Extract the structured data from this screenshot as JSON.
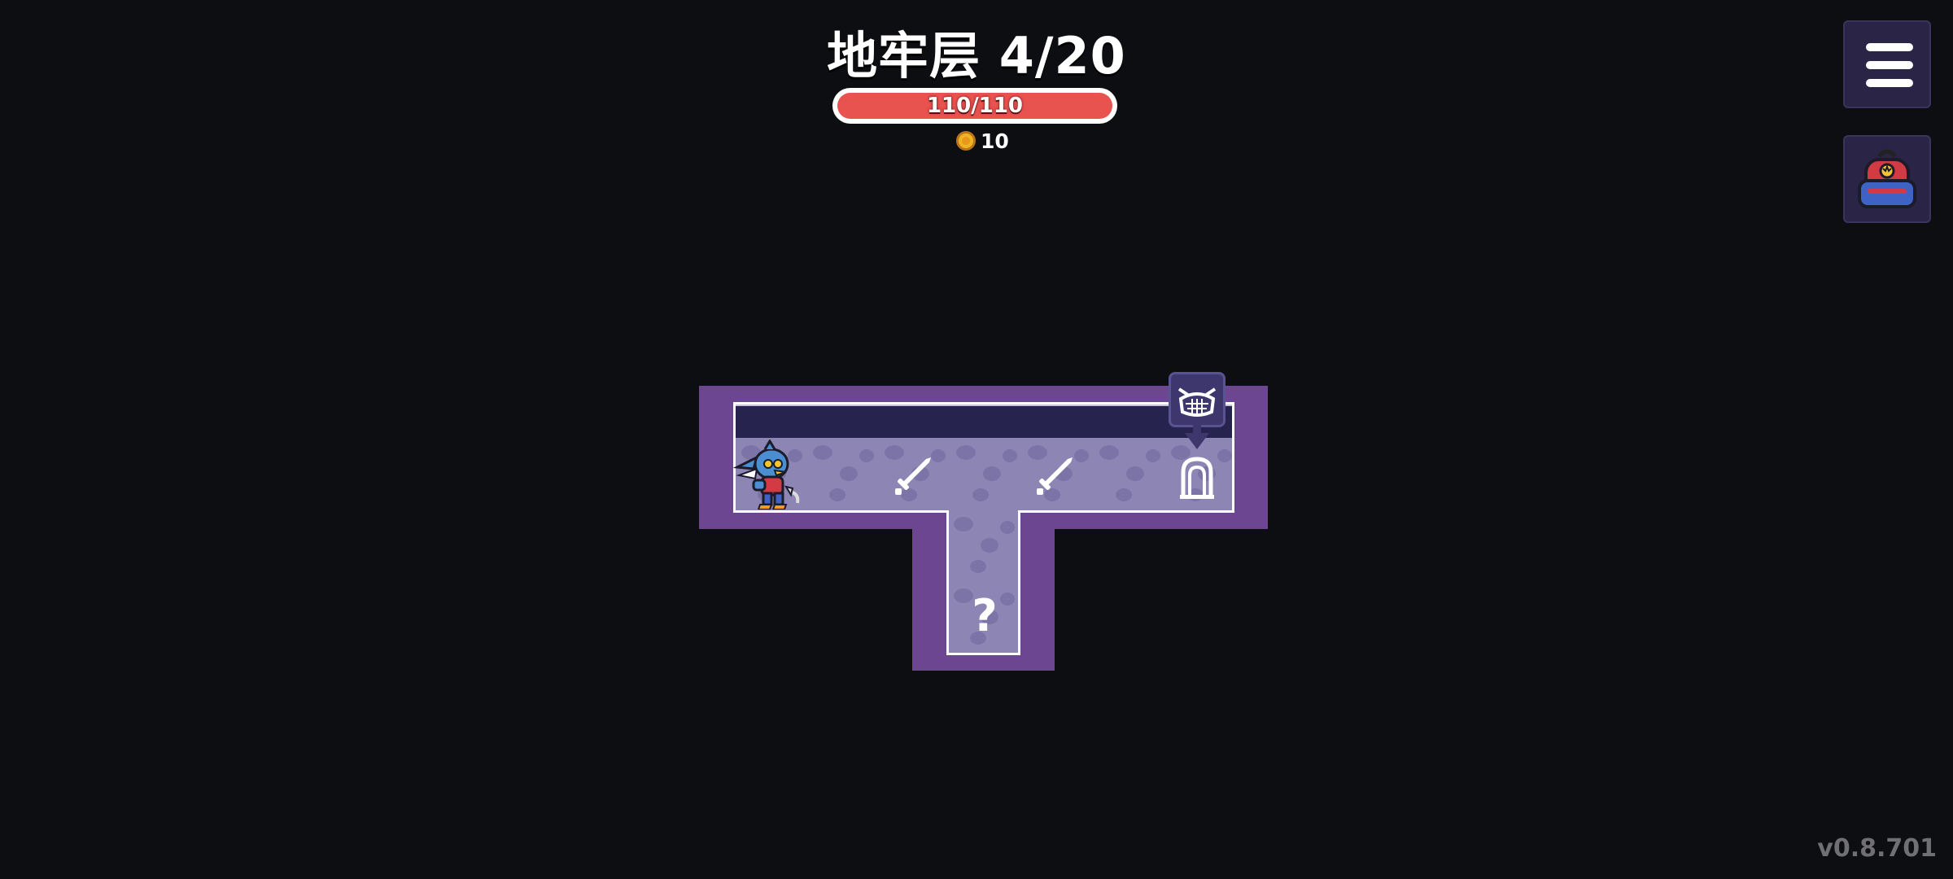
{
  "header": {
    "title": "地牢层 4/20",
    "hp_text": "110/110",
    "hp_current": 110,
    "hp_max": 110,
    "gold": "10"
  },
  "icons": {
    "menu": "hamburger-menu-icon",
    "inventory": "backpack-icon",
    "coin": "coin-icon",
    "boss": "boss-face-icon",
    "exit": "door-arch-icon",
    "battle": "sword-icon",
    "unknown": "question-mark-icon",
    "player": "player-character"
  },
  "map": {
    "unknown_label": "?"
  },
  "colors": {
    "hp_fill": "#e8524f",
    "wall": "#6c4691",
    "floor": "#8d86b5",
    "button_bg": "#2a2446",
    "background": "#0d0e11"
  },
  "footer": {
    "version": "v0.8.701"
  }
}
